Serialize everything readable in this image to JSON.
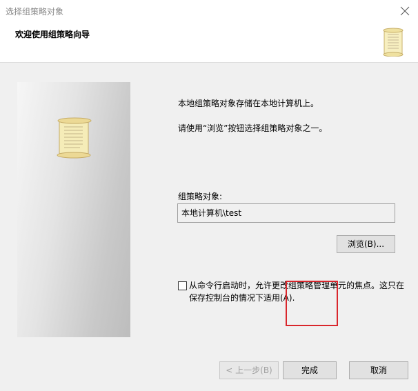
{
  "window": {
    "title": "选择组策略对象"
  },
  "header": {
    "heading": "欢迎使用组策略向导"
  },
  "intro": {
    "line1": "本地组策略对象存储在本地计算机上。",
    "line2": "请使用“浏览”按钮选择组策略对象之一。"
  },
  "gpo": {
    "label": "组策略对象:",
    "value": "本地计算机\\test"
  },
  "buttons": {
    "browse": "浏览(B)...",
    "back": "< 上一步(B)",
    "finish": "完成",
    "cancel": "取消"
  },
  "option": {
    "label": "从命令行启动时，允许更改组策略管理单元的焦点。这只在保存控制台的情况下适用(A).",
    "checked": false
  },
  "icons": {
    "close": "close-icon",
    "header_icon": "scroll-icon",
    "side_icon": "scroll-icon"
  },
  "colors": {
    "highlight": "#d9262c",
    "dialog_bg": "#f0f0f0"
  }
}
